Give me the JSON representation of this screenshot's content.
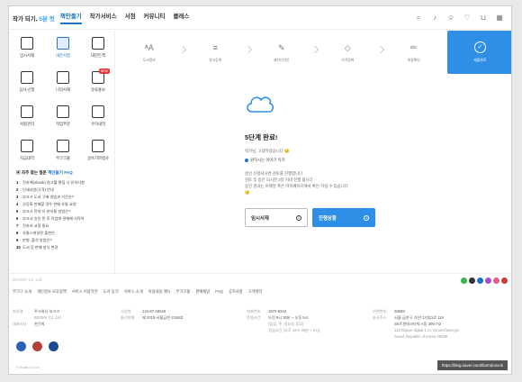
{
  "brand": {
    "name": "작가 되기, ",
    "accent": "5분 컷",
    "accent_color": "#3aa0e8"
  },
  "topnav": {
    "items": [
      "책만들기",
      "작가서비스",
      "서점",
      "커뮤니티",
      "클래스"
    ],
    "active_index": 0,
    "icons": [
      "search-icon",
      "bell-icon",
      "person-icon",
      "heart-icon",
      "cart-icon",
      "grid-icon"
    ]
  },
  "leftmenu": {
    "items": [
      {
        "label": "임시서재",
        "icon": "pencil-icon"
      },
      {
        "label": "내문서함",
        "icon": "book-icon",
        "active": true
      },
      {
        "label": "내만든책",
        "icon": "tablet-icon"
      },
      {
        "label": "심사·신청",
        "icon": "thumbsup-icon"
      },
      {
        "label": "나의서재",
        "icon": "bookshelf-icon"
      },
      {
        "label": "유료홍보",
        "icon": "megaphone-icon",
        "badge": "NEW"
      },
      {
        "label": "서평관리",
        "icon": "comment-icon"
      },
      {
        "label": "작업주문",
        "icon": "bag-icon"
      },
      {
        "label": "수익내역",
        "icon": "coin-icon"
      },
      {
        "label": "지급내역",
        "icon": "calculator-icon"
      },
      {
        "label": "부크크몰",
        "icon": "box-icon"
      },
      {
        "label": "글쓰기마법사",
        "icon": "wand-icon"
      }
    ]
  },
  "faq": {
    "title_prefix": "자주 찾는 질문 ",
    "title_highlight": "책만들기 FAQ",
    "items": [
      "전자책(ebook) 원고를 편집 시 유의사항",
      "인쇄사양(규격) 안내",
      "부크크 도서 구매 방법과 기간은?",
      "균등화 판매할 경우 판매 유통 요청",
      "부크크 전자 유·판유통 방법은?",
      "부크크 승인 된 후 작업에 관해해 시작하",
      "전자서 교정 필요",
      "유통스케일된 출판은",
      "판형, 출석 방법은?",
      "도서 등 판매 방식 변경"
    ]
  },
  "steps": [
    {
      "label": "도서정보",
      "icon": "text-size-icon"
    },
    {
      "label": "원고등록",
      "icon": "lines-icon"
    },
    {
      "label": "표지디자인",
      "icon": "brush-icon"
    },
    {
      "label": "가격정책",
      "icon": "tag-icon"
    },
    {
      "label": "최종확인",
      "icon": "abc-check-icon"
    },
    {
      "label": "제출완료",
      "icon": "check-circle-icon",
      "active": true
    }
  ],
  "content": {
    "title": "5단계 완료!",
    "subtitle": "작가님, 고생하셨습니다 😊",
    "status": "원하시는 이야기 작가",
    "note_lines": [
      "승인 신청되시면 검토를 진행합니다",
      "검토 후 승인 되시면 2일 이내 진행 됩니다",
      "승인 결과는 이메일 혹은 마이페이지에서 확인 하실 수 있습니다"
    ],
    "note_emoji": "🙂",
    "btn_draft": "임시서재",
    "btn_progress": "진행상황",
    "accent": "#2f8fe6"
  },
  "footer": {
    "brand": "BOOKK Co.,Ltd",
    "links": [
      "부크크 소개",
      "개인정보 보호정책",
      "서비스 이용약관",
      "도서 등기",
      "서비스 소개",
      "이용내용 매뉴",
      "부크크몰",
      "판매채널",
      "FAQ",
      "공지사항",
      "고객센터"
    ],
    "company_label": "회사명",
    "company_value": "주식회사 부크크",
    "company_sub": "BOOKK Co.,Ltd",
    "ceo_label": "대표이사",
    "ceo_value": "한건희",
    "biz_label": "사업자",
    "biz_value": "134-87-28049",
    "mail_label": "통신판매",
    "mail_value": "제 2019-서울금천-2166호",
    "tel_label": "대표번호",
    "tel_value": "1670-8316",
    "hours_label": "운영시간",
    "hours_value": "오전 9시 30분 ~ 오후 5시",
    "hours_sub1": "(점심, 주, 일요일 휴무)",
    "hours_sub2": "점심시간 (오후 12시 30분 ~ 1시)",
    "zip_label": "우편번호",
    "zip_value": "08589",
    "addr_label": "본사주소",
    "addr_value": "서울 금천구 가산디지털1로 119",
    "addr_line2": "SK트윈테크타워 A동 305-7호",
    "addr_en1": "119 Gasan digital 1 ro, Geumcheon-gu",
    "addr_en2": "Seoul, Republic of Korea 08589",
    "copyright": "© Bookk Co.,Ltd",
    "blog_url": "https://blog.naver.com/tlarmdosook"
  },
  "social_colors": [
    "#3cb54a",
    "#333333",
    "#1a73c8",
    "#a64bd6",
    "#e85d8a",
    "#cc3b3b"
  ],
  "logo_colors": [
    "#2a5fb4",
    "#b04038",
    "#1c4a8e"
  ]
}
